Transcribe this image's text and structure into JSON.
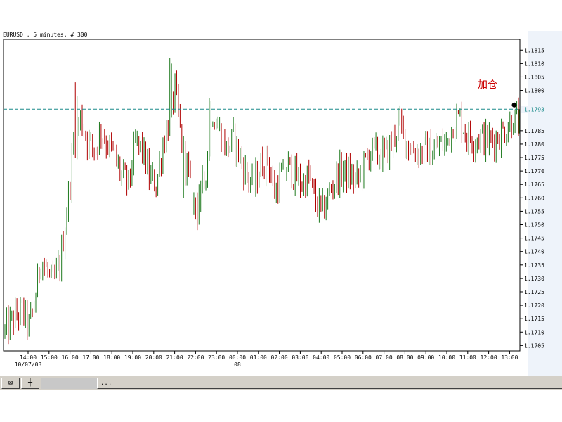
{
  "chart_title": "EURUSD , 5 minutes, # 300",
  "annotation": "加仓",
  "colors": {
    "up": "#1f7a1f",
    "down": "#b00000",
    "dashed_line": "#1a8a8a",
    "annotation": "#cc0000",
    "dot": "#000000"
  },
  "bottom_bar": {
    "tab_1_icon": "⊠",
    "tab_2_icon": "┼",
    "scroll_text": "..."
  },
  "chart_data": {
    "type": "candlestick",
    "ylim": [
      1.1703,
      1.1819
    ],
    "yticks": [
      "1.1705",
      "1.1710",
      "1.1715",
      "1.1720",
      "1.1725",
      "1.1730",
      "1.1735",
      "1.1740",
      "1.1745",
      "1.1750",
      "1.1755",
      "1.1760",
      "1.1765",
      "1.1770",
      "1.1775",
      "1.1780",
      "1.1785",
      "1.1800",
      "1.1805",
      "1.1810",
      "1.1815"
    ],
    "current_price_label": "1.1793",
    "current_price": 1.1793,
    "xticks": [
      "14:00",
      "15:00",
      "16:00",
      "17:00",
      "18:00",
      "19:00",
      "20:00",
      "21:00",
      "22:00",
      "23:00",
      "00:00",
      "01:00",
      "02:00",
      "03:00",
      "04:00",
      "05:00",
      "06:00",
      "07:00",
      "08:00",
      "09:00",
      "10:00",
      "11:00",
      "12:00",
      "13:00"
    ],
    "date_labels": [
      {
        "text": "10/07/03",
        "at": "14:00"
      },
      {
        "text": "08",
        "at": "00:00"
      }
    ],
    "trend": [
      [
        0,
        1.171
      ],
      [
        5,
        1.1715
      ],
      [
        10,
        1.1718
      ],
      [
        14,
        1.1712
      ],
      [
        17,
        1.172
      ],
      [
        21,
        1.1738
      ],
      [
        24,
        1.1733
      ],
      [
        28,
        1.1728
      ],
      [
        32,
        1.1735
      ],
      [
        36,
        1.1755
      ],
      [
        40,
        1.178
      ],
      [
        44,
        1.179
      ],
      [
        48,
        1.1782
      ],
      [
        52,
        1.1778
      ],
      [
        56,
        1.1785
      ],
      [
        60,
        1.178
      ],
      [
        64,
        1.1775
      ],
      [
        68,
        1.1768
      ],
      [
        72,
        1.1765
      ],
      [
        76,
        1.178
      ],
      [
        80,
        1.1778
      ],
      [
        84,
        1.1768
      ],
      [
        88,
        1.1765
      ],
      [
        92,
        1.178
      ],
      [
        96,
        1.179
      ],
      [
        99,
        1.18
      ],
      [
        103,
        1.178
      ],
      [
        107,
        1.1768
      ],
      [
        111,
        1.1755
      ],
      [
        114,
        1.176
      ],
      [
        118,
        1.1775
      ],
      [
        121,
        1.1792
      ],
      [
        125,
        1.1785
      ],
      [
        129,
        1.1778
      ],
      [
        133,
        1.1782
      ],
      [
        137,
        1.1775
      ],
      [
        141,
        1.1768
      ],
      [
        145,
        1.1765
      ],
      [
        149,
        1.1772
      ],
      [
        153,
        1.1775
      ],
      [
        157,
        1.1762
      ],
      [
        161,
        1.1768
      ],
      [
        165,
        1.1772
      ],
      [
        169,
        1.1768
      ],
      [
        173,
        1.1765
      ],
      [
        177,
        1.1768
      ],
      [
        181,
        1.1758
      ],
      [
        185,
        1.1755
      ],
      [
        189,
        1.1762
      ],
      [
        193,
        1.1768
      ],
      [
        197,
        1.177
      ],
      [
        201,
        1.1768
      ],
      [
        205,
        1.1766
      ],
      [
        209,
        1.1772
      ],
      [
        213,
        1.1778
      ],
      [
        217,
        1.1776
      ],
      [
        221,
        1.1776
      ],
      [
        225,
        1.178
      ],
      [
        229,
        1.1788
      ],
      [
        233,
        1.1782
      ],
      [
        237,
        1.1778
      ],
      [
        241,
        1.1777
      ],
      [
        245,
        1.1778
      ],
      [
        249,
        1.1777
      ],
      [
        253,
        1.178
      ],
      [
        257,
        1.178
      ],
      [
        261,
        1.1788
      ],
      [
        265,
        1.179
      ],
      [
        269,
        1.1783
      ],
      [
        273,
        1.1782
      ],
      [
        277,
        1.1783
      ],
      [
        281,
        1.1781
      ],
      [
        285,
        1.1782
      ],
      [
        289,
        1.1784
      ],
      [
        292,
        1.1786
      ],
      [
        295,
        1.1789
      ]
    ],
    "spikes": [
      {
        "i": 41,
        "low": 1.1775,
        "high": 1.1803
      },
      {
        "i": 42,
        "low": 1.1778,
        "high": 1.1798
      },
      {
        "i": 96,
        "low": 1.1785,
        "high": 1.1812
      },
      {
        "i": 97,
        "low": 1.179,
        "high": 1.181
      },
      {
        "i": 104,
        "low": 1.176,
        "high": 1.1773
      },
      {
        "i": 112,
        "low": 1.1748,
        "high": 1.1762
      },
      {
        "i": 113,
        "low": 1.175,
        "high": 1.1765
      },
      {
        "i": 119,
        "low": 1.1788,
        "high": 1.1797
      },
      {
        "i": 120,
        "low": 1.1785,
        "high": 1.1796
      },
      {
        "i": 185,
        "low": 1.1755,
        "high": 1.1762
      },
      {
        "i": 186,
        "low": 1.1755,
        "high": 1.176
      }
    ]
  }
}
